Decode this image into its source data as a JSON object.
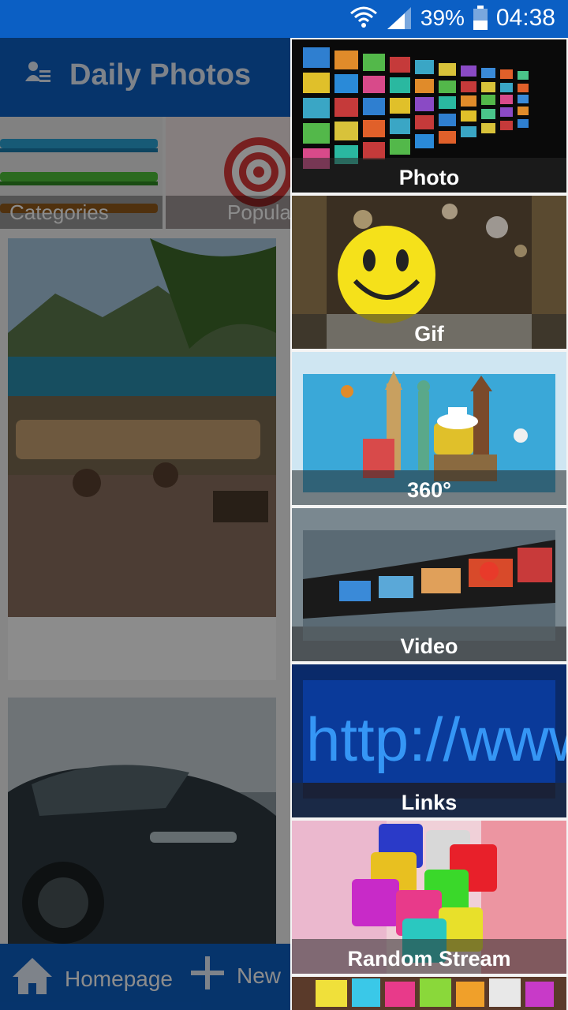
{
  "status_bar": {
    "battery": "39%",
    "time": "04:38",
    "icons": [
      "wifi-icon",
      "signal-icon",
      "battery-icon"
    ]
  },
  "app_bar": {
    "title": "Daily Photos",
    "icon": "user-list-icon"
  },
  "tiles": [
    {
      "label": "Categories"
    },
    {
      "label": "Popula"
    }
  ],
  "bottom_nav": {
    "home": "Homepage",
    "new": "New"
  },
  "drawer": {
    "items": [
      {
        "label": "Photo"
      },
      {
        "label": "Gif"
      },
      {
        "label": "360°"
      },
      {
        "label": "Video"
      },
      {
        "label": "Links"
      },
      {
        "label": "Random Stream"
      }
    ]
  },
  "colors": {
    "primary": "#0b5fc4",
    "accent_red": "#d93b3b",
    "scrim": "rgba(0,0,0,0.45)"
  }
}
